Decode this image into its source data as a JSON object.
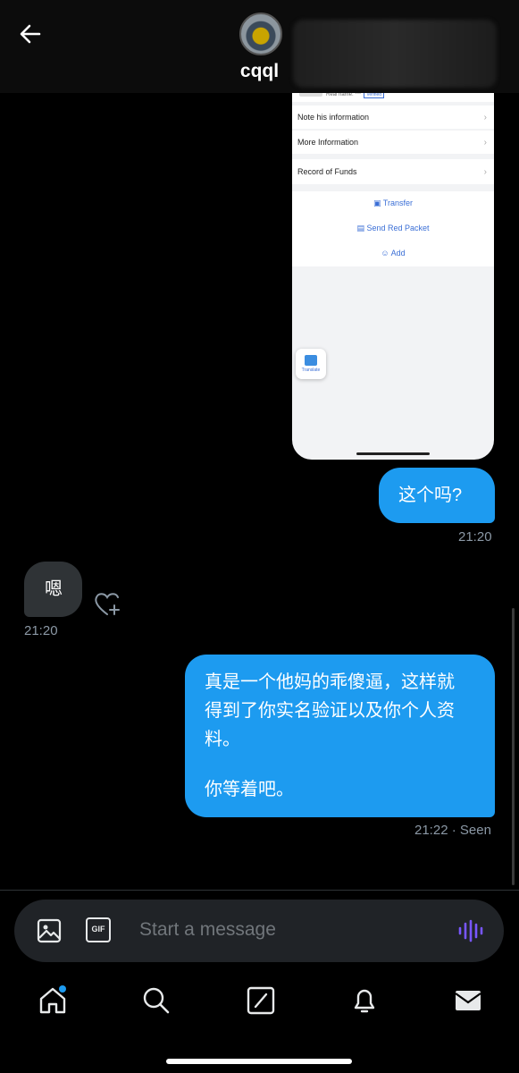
{
  "header": {
    "title": "cqql"
  },
  "screenshot": {
    "real_name_label": "Real name: ***",
    "verified_label": "Verified",
    "rows": [
      "Note his information",
      "More Information",
      "Record of Funds"
    ],
    "actions": [
      "Transfer",
      "Send Red Packet",
      "Add"
    ],
    "translate_label": "Translate"
  },
  "messages": [
    {
      "direction": "out",
      "text": "这个吗?",
      "time": "21:20"
    },
    {
      "direction": "in",
      "text": "嗯",
      "time": "21:20"
    },
    {
      "direction": "out",
      "lines": [
        "真是一个他妈的乖傻逼，这样就",
        "得到了你实名验证以及你个人资",
        "料。",
        "",
        "你等着吧。"
      ],
      "time": "21:22",
      "status": "· Seen"
    }
  ],
  "composer": {
    "placeholder": "Start a message",
    "gif_label": "GIF",
    "icons": [
      "image-icon",
      "gif-icon",
      "voice-icon"
    ]
  },
  "nav": {
    "items": [
      "home-icon",
      "search-icon",
      "grok-icon",
      "notifications-icon",
      "messages-icon"
    ],
    "accent": "#1d9bf0"
  },
  "colors": {
    "outgoing_bubble": "#1d9bf0",
    "incoming_bubble": "#2f3336",
    "background": "#000000"
  }
}
